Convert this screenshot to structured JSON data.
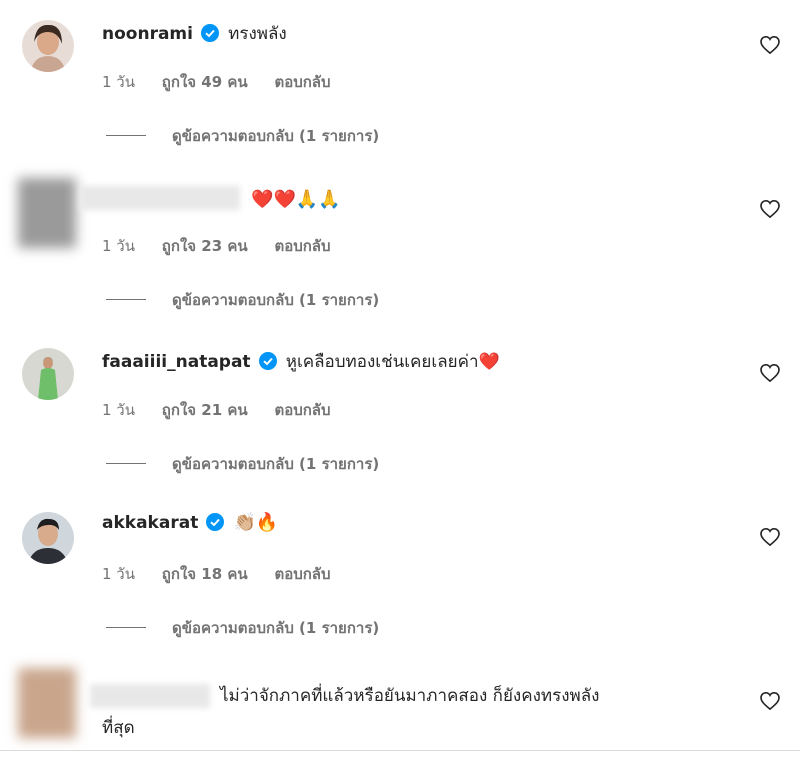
{
  "comments": [
    {
      "username": "noonrami",
      "verified": true,
      "text": "ทรงพลัง",
      "time": "1 วัน",
      "likes": "ถูกใจ 49 คน",
      "reply": "ตอบกลับ",
      "replies": "ดูข้อความตอบกลับ (1 รายการ)"
    },
    {
      "username": "",
      "verified": false,
      "text": "❤️❤️🙏🙏",
      "time": "1 วัน",
      "likes": "ถูกใจ 23 คน",
      "reply": "ตอบกลับ",
      "replies": "ดูข้อความตอบกลับ (1 รายการ)"
    },
    {
      "username": "faaaiiii_natapat",
      "verified": true,
      "text": "หูเคลือบทองเช่นเคยเลยค่า❤️",
      "time": "1 วัน",
      "likes": "ถูกใจ 21 คน",
      "reply": "ตอบกลับ",
      "replies": "ดูข้อความตอบกลับ (1 รายการ)"
    },
    {
      "username": "akkakarat",
      "verified": true,
      "text": "👏🏼🔥",
      "time": "1 วัน",
      "likes": "ถูกใจ 18 คน",
      "reply": "ตอบกลับ",
      "replies": "ดูข้อความตอบกลับ (1 รายการ)"
    },
    {
      "username": "",
      "verified": false,
      "text_line1": "ไม่ว่าจักภาคที่แล้วหรือยันมาภาคสอง ก็ยังคงทรงพลัง",
      "text_line2": "ที่สุด"
    }
  ],
  "colors": {
    "verified_badge": "#0095f6",
    "secondary_text": "#737373",
    "primary_text": "#262626"
  }
}
